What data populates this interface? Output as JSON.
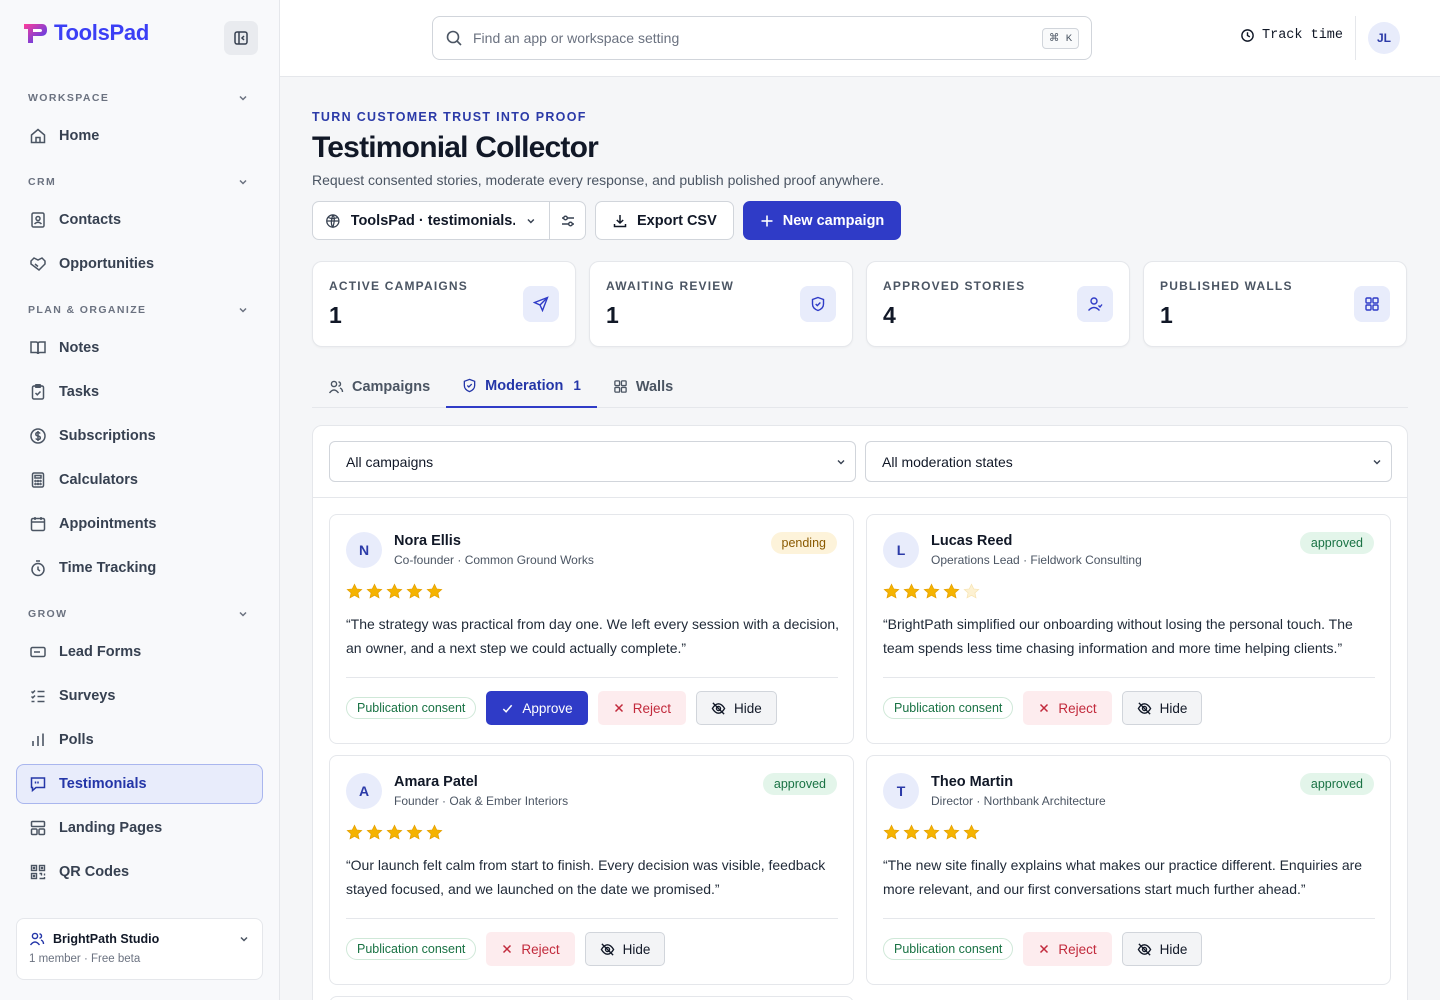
{
  "brand": {
    "name": "ToolsPad"
  },
  "sidebar": {
    "sections": [
      {
        "label": "WORKSPACE",
        "items": [
          {
            "label": "Home",
            "icon": "home-icon"
          }
        ]
      },
      {
        "label": "CRM",
        "items": [
          {
            "label": "Contacts",
            "icon": "contact-card-icon"
          },
          {
            "label": "Opportunities",
            "icon": "handshake-icon"
          }
        ]
      },
      {
        "label": "PLAN & ORGANIZE",
        "items": [
          {
            "label": "Notes",
            "icon": "book-icon"
          },
          {
            "label": "Tasks",
            "icon": "clipboard-check-icon"
          },
          {
            "label": "Subscriptions",
            "icon": "dollar-circle-icon"
          },
          {
            "label": "Calculators",
            "icon": "calculator-icon"
          },
          {
            "label": "Appointments",
            "icon": "calendar-icon"
          },
          {
            "label": "Time Tracking",
            "icon": "stopwatch-icon"
          }
        ]
      },
      {
        "label": "GROW",
        "items": [
          {
            "label": "Lead Forms",
            "icon": "form-icon"
          },
          {
            "label": "Surveys",
            "icon": "checklist-icon"
          },
          {
            "label": "Polls",
            "icon": "bar-chart-icon"
          },
          {
            "label": "Testimonials",
            "icon": "message-quote-icon",
            "active": true
          },
          {
            "label": "Landing Pages",
            "icon": "layout-icon"
          },
          {
            "label": "QR Codes",
            "icon": "qr-code-icon"
          }
        ]
      }
    ],
    "workspace": {
      "name": "BrightPath Studio",
      "meta": "1 member · Free beta"
    }
  },
  "topbar": {
    "search_placeholder": "Find an app or workspace setting",
    "shortcut": "⌘ K",
    "track_time": "Track time",
    "avatar_initials": "JL"
  },
  "page": {
    "eyebrow": "TURN CUSTOMER TRUST INTO PROOF",
    "title": "Testimonial Collector",
    "subtitle": "Request consented stories, moderate every response, and publish polished proof anywhere.",
    "site_select": "ToolsPad · testimonials.toolspad",
    "export_label": "Export CSV",
    "new_campaign_label": "New campaign"
  },
  "stats": [
    {
      "label": "ACTIVE CAMPAIGNS",
      "value": "1",
      "icon": "send-icon"
    },
    {
      "label": "AWAITING REVIEW",
      "value": "1",
      "icon": "shield-check-icon"
    },
    {
      "label": "APPROVED STORIES",
      "value": "4",
      "icon": "user-icon"
    },
    {
      "label": "PUBLISHED WALLS",
      "value": "1",
      "icon": "grid-icon"
    }
  ],
  "tabs": [
    {
      "label": "Campaigns",
      "icon": "users-icon"
    },
    {
      "label": "Moderation",
      "count": "1",
      "icon": "shield-check-icon",
      "active": true
    },
    {
      "label": "Walls",
      "icon": "grid-icon"
    }
  ],
  "filters": {
    "campaign": "All campaigns",
    "state": "All moderation states"
  },
  "labels": {
    "consent": "Publication consent",
    "approve": "Approve",
    "reject": "Reject",
    "hide": "Hide"
  },
  "testimonials": [
    {
      "initial": "N",
      "name": "Nora Ellis",
      "role": "Co-founder · Common Ground Works",
      "status": "pending",
      "rating": 5,
      "quote": "“The strategy was practical from day one. We left every session with a decision, an owner, and a next step we could actually complete.”"
    },
    {
      "initial": "L",
      "name": "Lucas Reed",
      "role": "Operations Lead · Fieldwork Consulting",
      "status": "approved",
      "rating": 4,
      "quote": "“BrightPath simplified our onboarding without losing the personal touch. The team spends less time chasing information and more time helping clients.”"
    },
    {
      "initial": "A",
      "name": "Amara Patel",
      "role": "Founder · Oak & Ember Interiors",
      "status": "approved",
      "rating": 5,
      "quote": "“Our launch felt calm from start to finish. Every decision was visible, feedback stayed focused, and we launched on the date we promised.”"
    },
    {
      "initial": "T",
      "name": "Theo Martin",
      "role": "Director · Northbank Architecture",
      "status": "approved",
      "rating": 5,
      "quote": "“The new site finally explains what makes our practice different. Enquiries are more relevant, and our first conversations start much further ahead.”"
    }
  ],
  "colors": {
    "accent": "#2f3bc7",
    "brand": "#3b3ff5",
    "pending": "#8a5a00",
    "approved": "#197244",
    "reject": "#c22a3c",
    "star": "#f5b300"
  }
}
